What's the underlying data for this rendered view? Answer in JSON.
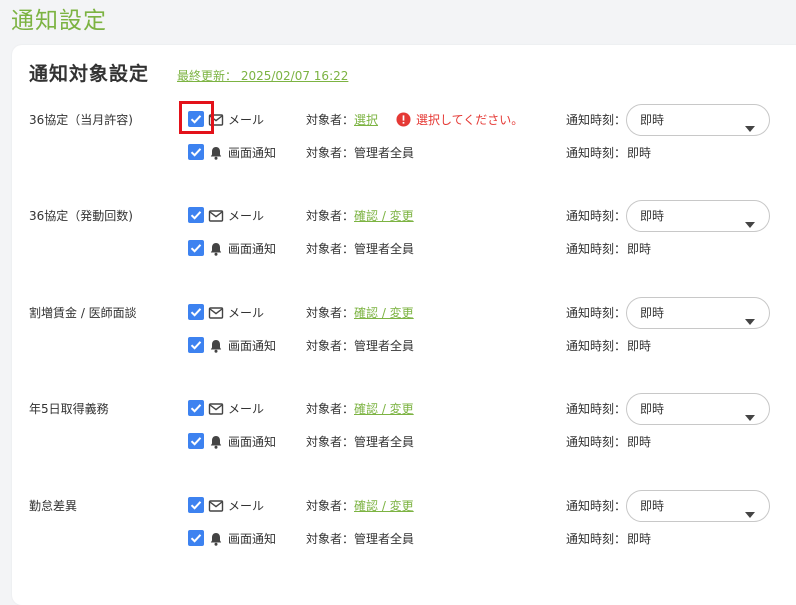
{
  "page_title": "通知設定",
  "card": {
    "title": "通知対象設定",
    "last_updated": "最終更新： 2025/02/07 16:22"
  },
  "labels": {
    "target": "対象者：",
    "time": "通知時刻："
  },
  "sections": [
    {
      "label": "36協定（当月許容)",
      "mail": {
        "label": "メール",
        "checked": true,
        "target_link": "選択",
        "error": "選択してください。",
        "time": "即時"
      },
      "screen": {
        "label": "画面通知",
        "checked": true,
        "target_value": "管理者全員",
        "time": "即時"
      }
    },
    {
      "label": "36協定（発動回数)",
      "mail": {
        "label": "メール",
        "checked": true,
        "target_link": "確認 / 変更",
        "time": "即時"
      },
      "screen": {
        "label": "画面通知",
        "checked": true,
        "target_value": "管理者全員",
        "time": "即時"
      }
    },
    {
      "label": "割増賃金 / 医師面談",
      "mail": {
        "label": "メール",
        "checked": true,
        "target_link": "確認 / 変更",
        "time": "即時"
      },
      "screen": {
        "label": "画面通知",
        "checked": true,
        "target_value": "管理者全員",
        "time": "即時"
      }
    },
    {
      "label": "年5日取得義務",
      "mail": {
        "label": "メール",
        "checked": true,
        "target_link": "確認 / 変更",
        "time": "即時"
      },
      "screen": {
        "label": "画面通知",
        "checked": true,
        "target_value": "管理者全員",
        "time": "即時"
      }
    },
    {
      "label": "勤怠差異",
      "mail": {
        "label": "メール",
        "checked": true,
        "target_link": "確認 / 変更",
        "time": "即時"
      },
      "screen": {
        "label": "画面通知",
        "checked": true,
        "target_value": "管理者全員",
        "time": "即時"
      }
    }
  ],
  "icons": {
    "mail": "mail-icon",
    "screen": "bell-icon",
    "error": "error-icon",
    "dropdown": "chevron-down-icon"
  },
  "colors": {
    "accent_green": "#7cb342",
    "checkbox_blue": "#3d82f0",
    "error_red": "#e53935",
    "highlight_red": "#e3121a"
  }
}
